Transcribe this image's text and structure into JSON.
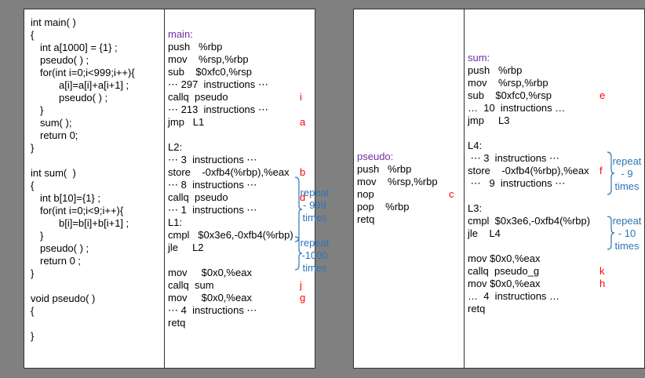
{
  "c_code": [
    {
      "t": "int main( )",
      "x": 8
    },
    {
      "t": "{",
      "x": 8
    },
    {
      "t": "int a[1000] = {1} ;",
      "x": 20
    },
    {
      "t": "pseudo( ) ;",
      "x": 20
    },
    {
      "t": "for(int i=0;i<999;i++){",
      "x": 20
    },
    {
      "t": "a[i]=a[i]+a[i+1] ;",
      "x": 44
    },
    {
      "t": "pseudo( ) ;",
      "x": 44
    },
    {
      "t": "}",
      "x": 20
    },
    {
      "t": "sum( );",
      "x": 20
    },
    {
      "t": "return 0;",
      "x": 20
    },
    {
      "t": "}",
      "x": 8
    },
    {
      "t": "",
      "x": 8
    },
    {
      "t": "int sum(  )",
      "x": 8
    },
    {
      "t": "{",
      "x": 8
    },
    {
      "t": "int b[10]={1} ;",
      "x": 20
    },
    {
      "t": "for(int i=0;i<9;i++){",
      "x": 20
    },
    {
      "t": "b[i]=b[i]+b[i+1] ;",
      "x": 44
    },
    {
      "t": "}",
      "x": 20
    },
    {
      "t": "pseudo( ) ;",
      "x": 20
    },
    {
      "t": "return 0 ;",
      "x": 20
    },
    {
      "t": "}",
      "x": 8
    },
    {
      "t": "",
      "x": 8
    },
    {
      "t": "void pseudo( )",
      "x": 8
    },
    {
      "t": "{",
      "x": 8
    },
    {
      "t": "",
      "x": 8
    },
    {
      "t": "}",
      "x": 8
    }
  ],
  "main_asm": [
    {
      "t": "main:",
      "c": "purple"
    },
    {
      "t": "push   %rbp"
    },
    {
      "t": "mov    %rsp,%rbp"
    },
    {
      "t": "sub    $0xfc0,%rsp"
    },
    {
      "t": "⋯ 297  instructions ⋯"
    },
    {
      "t": "callq  pseudo",
      "m": "i"
    },
    {
      "t": "⋯ 213  instructions ⋯"
    },
    {
      "t": "jmp   L1",
      "m": "a"
    },
    {
      "t": ""
    },
    {
      "t": "L2:"
    },
    {
      "t": "⋯ 3  instructions ⋯"
    },
    {
      "t": "store    -0xfb4(%rbp),%eax",
      "m": "b"
    },
    {
      "t": "⋯ 8  instructions ⋯"
    },
    {
      "t": "callq  pseudo",
      "m": "d"
    },
    {
      "t": "⋯ 1  instructions ⋯"
    },
    {
      "t": "L1:"
    },
    {
      "t": "cmpl   $0x3e6,-0xfb4(%rbp)"
    },
    {
      "t": "jle     L2"
    },
    {
      "t": ""
    },
    {
      "t": "mov     $0x0,%eax"
    },
    {
      "t": "callq  sum",
      "m": "j"
    },
    {
      "t": "mov     $0x0,%eax",
      "m": "g"
    },
    {
      "t": "⋯ 4  instructions ⋯"
    },
    {
      "t": "retq"
    }
  ],
  "pseudo_asm": [
    {
      "t": "pseudo:",
      "c": "purple"
    },
    {
      "t": "push   %rbp"
    },
    {
      "t": "mov    %rsp,%rbp"
    },
    {
      "t": "nop",
      "m": "c"
    },
    {
      "t": "pop    %rbp"
    },
    {
      "t": "retq"
    }
  ],
  "sum_asm": [
    {
      "t": "sum:",
      "c": "purple"
    },
    {
      "t": "push   %rbp"
    },
    {
      "t": "mov    %rsp,%rbp"
    },
    {
      "t": "sub    $0xfc0,%rsp",
      "m": "e"
    },
    {
      "t": "…  10  instructions …"
    },
    {
      "t": "jmp     L3"
    },
    {
      "t": ""
    },
    {
      "t": "L4:"
    },
    {
      "t": " ⋯ 3  instructions ⋯"
    },
    {
      "t": "store    -0xfb4(%rbp),%eax",
      "m": "f"
    },
    {
      "t": " ⋯   9  instructions ⋯"
    },
    {
      "t": ""
    },
    {
      "t": "L3:"
    },
    {
      "t": "cmpl  $0x3e6,-0xfb4(%rbp)"
    },
    {
      "t": "jle    L4"
    },
    {
      "t": ""
    },
    {
      "t": "mov $0x0,%eax"
    },
    {
      "t": "callq  pseudo_g",
      "m": "k"
    },
    {
      "t": "mov $0x0,%eax",
      "m": "h"
    },
    {
      "t": "…  4  instructions …"
    },
    {
      "t": "retq"
    }
  ],
  "annotations": {
    "main_l2_loop": [
      "repeat",
      "999",
      "times"
    ],
    "main_l1_loop": [
      "repeat",
      "1000",
      "times"
    ],
    "sum_l4_loop": [
      "repeat",
      "9",
      "times"
    ],
    "sum_l3_loop": [
      "repeat",
      "10",
      "times"
    ]
  },
  "colors": {
    "background": "#808080",
    "label_purple": "#7030a0",
    "marker_red": "#ff0000",
    "annotation_blue": "#2e75b6"
  }
}
